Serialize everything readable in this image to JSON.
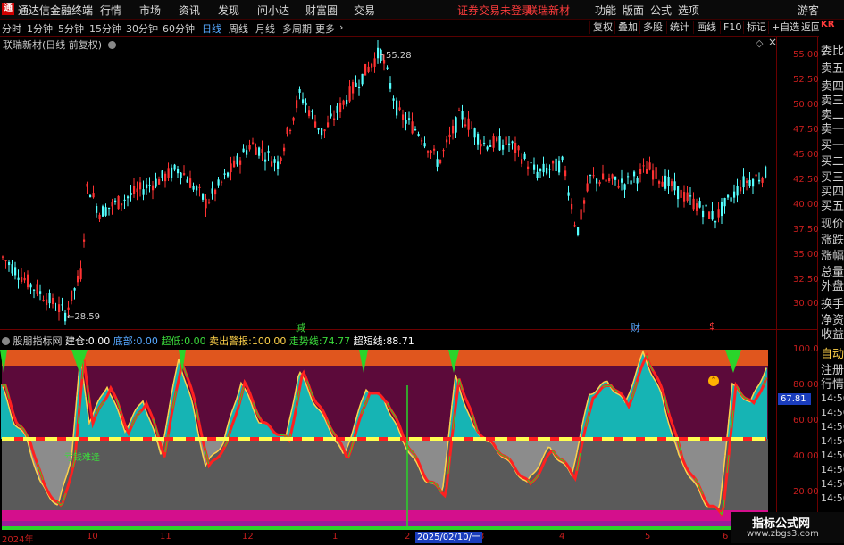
{
  "menubar": {
    "app_title": "通达信金融终端",
    "menus": [
      "行情",
      "市场",
      "资讯",
      "发现",
      "问小达",
      "财富圈",
      "交易"
    ],
    "notice_login": "证券交易未登录",
    "notice_stock": "联瑞新材",
    "sys": [
      "功能",
      "版面",
      "公式",
      "选项"
    ],
    "guest": "游客"
  },
  "toolbar": {
    "periods": [
      "分时",
      "1分钟",
      "5分钟",
      "15分钟",
      "30分钟",
      "60分钟",
      "日线",
      "周线",
      "月线",
      "多周期",
      "更多"
    ],
    "active_period": "日线",
    "right": [
      "复权",
      "叠加",
      "多股",
      "统计",
      "画线",
      "F10",
      "标记",
      "+自选",
      "返回"
    ]
  },
  "chart": {
    "title": "联瑞新材(日线 前复权)",
    "price_axis": [
      "55.00",
      "52.50",
      "50.00",
      "47.50",
      "45.00",
      "42.50",
      "40.00",
      "37.50",
      "35.00",
      "32.50",
      "30.00"
    ],
    "high_label": "55.28",
    "low_label": "28.59",
    "markers": {
      "m1": "减",
      "m2": "财",
      "m3": "$"
    }
  },
  "indicator": {
    "name": "股朋指标网",
    "fields": [
      {
        "label": "建仓:",
        "value": "0.00",
        "color": "#ffffff"
      },
      {
        "label": "底部:",
        "value": "0.00",
        "color": "#56a8ff"
      },
      {
        "label": "超低:",
        "value": "0.00",
        "color": "#3cdc3c"
      },
      {
        "label": "卖出警报:",
        "value": "100.00",
        "color": "#ffd24a"
      },
      {
        "label": "走势线:",
        "value": "74.77",
        "color": "#3cdc3c"
      },
      {
        "label": "超短线:",
        "value": "88.71",
        "color": "#ffffff"
      }
    ],
    "axis": [
      "100.0",
      "80.00",
      "60.00",
      "40.00",
      "20.00"
    ],
    "current_value": "67.81",
    "annotation": "亏钱难逢"
  },
  "time_axis": {
    "labels": [
      "2024年",
      "10",
      "11",
      "12",
      "1",
      "2",
      "3",
      "4",
      "5",
      "6"
    ],
    "crosshair_date": "2025/02/10/一"
  },
  "right_panel": {
    "top_code": "KR",
    "items": [
      "委比",
      "卖五",
      "卖四",
      "卖三",
      "卖二",
      "卖一",
      "买一",
      "买二",
      "买三",
      "买四",
      "买五",
      "现价",
      "涨跌",
      "涨幅",
      "总量",
      "外盘",
      "换手",
      "净资",
      "收益"
    ],
    "tabs": [
      "自动",
      "注册",
      "行情"
    ],
    "times": [
      "14:56",
      "14:56",
      "14:56",
      "14:56",
      "14:56",
      "14:56",
      "14:56",
      "14:56",
      "14:56",
      "14:56"
    ]
  },
  "watermark": {
    "line1": "指标公式网",
    "line2": "www.zbgs3.com"
  },
  "colors": {
    "up": "#ff3232",
    "down": "#54ffff",
    "grid": "#6b0000"
  }
}
